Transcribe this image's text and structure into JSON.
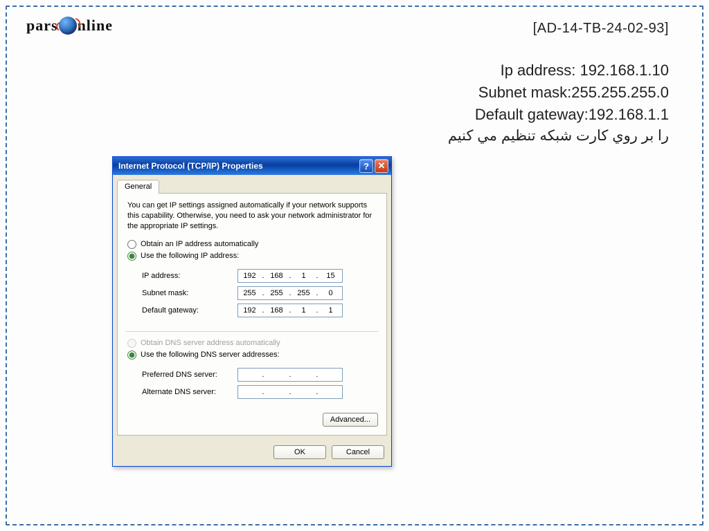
{
  "logo": {
    "prefix": "pars",
    "suffix": "nline"
  },
  "doc_code": "[AD-14-TB-24-02-93]",
  "info": {
    "line1": "Ip address:  192.168.1.10",
    "line2": "Subnet mask:255.255.255.0",
    "line3": "Default gateway:192.168.1.1",
    "line4_farsi": "را  بر  روي كارت شبكه  تنظيم مي كنيم"
  },
  "dialog": {
    "title": "Internet Protocol (TCP/IP) Properties",
    "help_glyph": "?",
    "close_glyph": "✕",
    "tab_general": "General",
    "description": "You can get IP settings assigned automatically if your network supports this capability. Otherwise, you need to ask your network administrator for the appropriate IP settings.",
    "radio_ip_auto": "Obtain an IP address automatically",
    "radio_ip_manual": "Use the following IP address:",
    "fields": {
      "ip_label": "IP address:",
      "ip_octets": [
        "192",
        "168",
        "1",
        "15"
      ],
      "subnet_label": "Subnet mask:",
      "subnet_octets": [
        "255",
        "255",
        "255",
        "0"
      ],
      "gateway_label": "Default gateway:",
      "gateway_octets": [
        "192",
        "168",
        "1",
        "1"
      ]
    },
    "radio_dns_auto": "Obtain DNS server address automatically",
    "radio_dns_manual": "Use the following DNS server addresses:",
    "dns": {
      "preferred_label": "Preferred DNS server:",
      "preferred_octets": [
        "",
        "",
        "",
        ""
      ],
      "alternate_label": "Alternate DNS server:",
      "alternate_octets": [
        "",
        "",
        "",
        ""
      ]
    },
    "advanced_btn": "Advanced...",
    "ok_btn": "OK",
    "cancel_btn": "Cancel"
  }
}
